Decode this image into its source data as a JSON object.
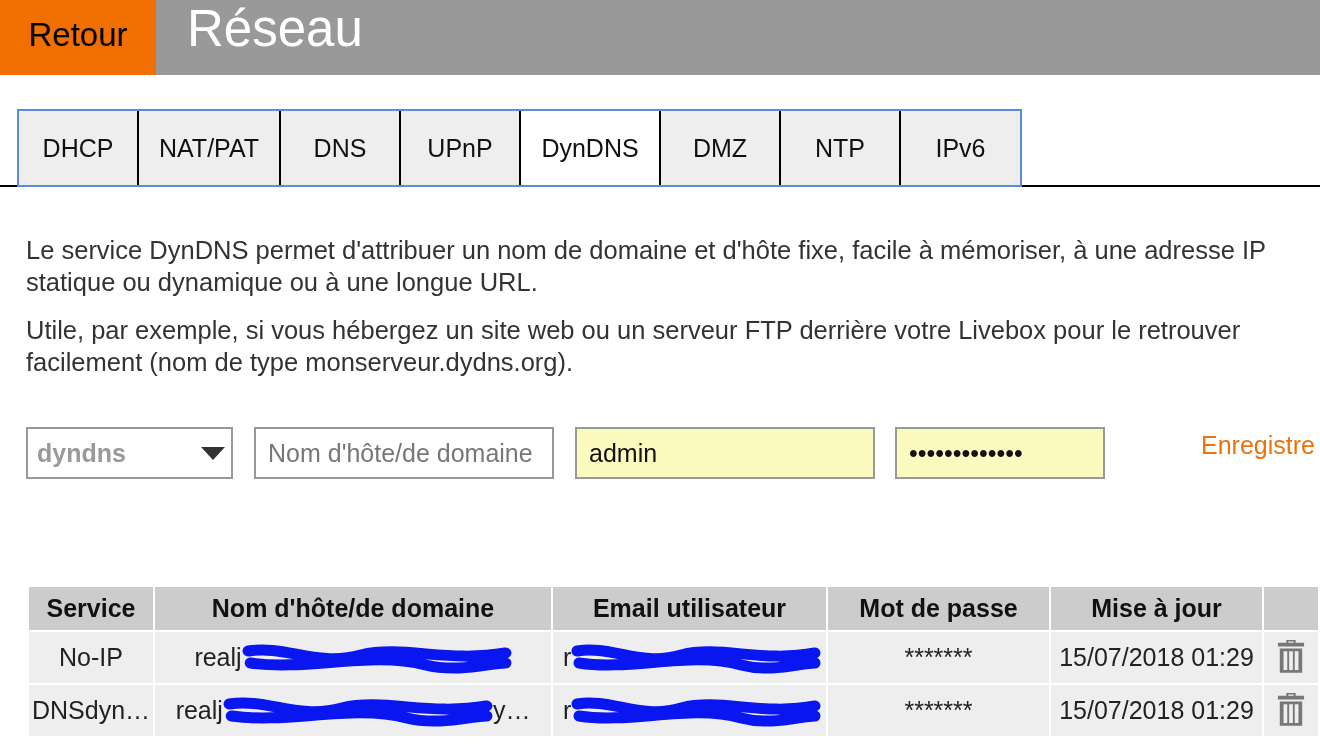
{
  "header": {
    "back_button": "Retour",
    "title": "Réseau"
  },
  "tabs": [
    {
      "label": "DHCP",
      "selected": false
    },
    {
      "label": "NAT/PAT",
      "selected": false
    },
    {
      "label": "DNS",
      "selected": false
    },
    {
      "label": "UPnP",
      "selected": false
    },
    {
      "label": "DynDNS",
      "selected": true
    },
    {
      "label": "DMZ",
      "selected": false
    },
    {
      "label": "NTP",
      "selected": false
    },
    {
      "label": "IPv6",
      "selected": false
    }
  ],
  "description": [
    "Le service DynDNS permet d'attribuer un nom de domaine et d'hôte fixe, facile à mémoriser, à une adresse IP statique ou dynamique ou à une longue URL.",
    "Utile, par exemple, si vous hébergez un site web ou un serveur FTP derrière votre Livebox pour le retrouver facilement (nom de type monserveur.dydns.org)."
  ],
  "form": {
    "service_select": {
      "value": "dyndns",
      "disabled": true
    },
    "hostname_field": {
      "placeholder": "Nom d'hôte/de domaine",
      "autofilled": false
    },
    "username_field": {
      "value": "admin",
      "autofilled": true
    },
    "password_field": {
      "value": "•••••••••••••",
      "autofilled": true
    },
    "save_link": "Enregistre"
  },
  "table": {
    "columns": [
      "Service",
      "Nom d'hôte/de domaine",
      "Email utilisateur",
      "Mot de passe",
      "Mise à jour"
    ],
    "rows": [
      {
        "cells": [
          {
            "kind": "text",
            "text": "No-IP"
          },
          {
            "kind": "redacted",
            "visible": "realj"
          },
          {
            "kind": "redacted",
            "visible": "r"
          },
          {
            "kind": "text",
            "text": "*******"
          },
          {
            "kind": "text",
            "text": "15/07/2018 01:29"
          }
        ]
      },
      {
        "cells": [
          {
            "kind": "text",
            "text": "DNSdyn…"
          },
          {
            "kind": "redacted",
            "visible": "realj",
            "tail": "y…"
          },
          {
            "kind": "redacted",
            "visible": "r"
          },
          {
            "kind": "text",
            "text": "*******"
          },
          {
            "kind": "text",
            "text": "15/07/2018 01:29"
          }
        ]
      }
    ]
  }
}
